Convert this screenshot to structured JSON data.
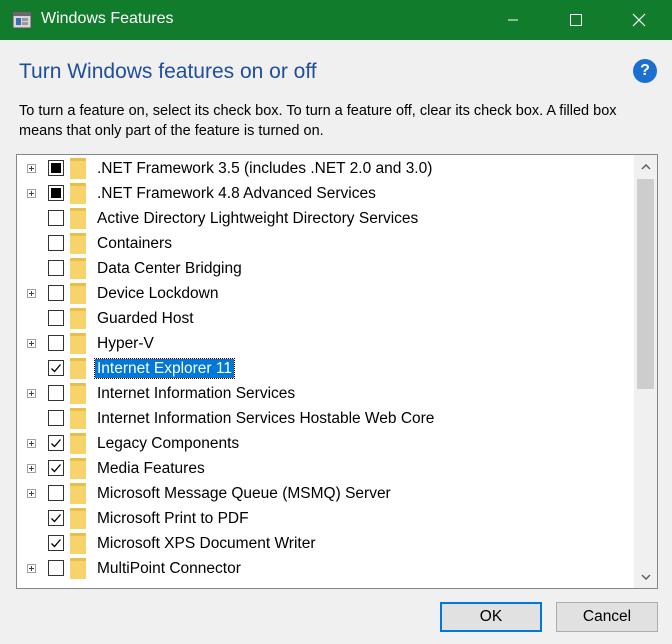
{
  "window": {
    "title": "Windows Features",
    "icon": "windows-features-icon",
    "controls": [
      "minimize-icon",
      "maximize-icon",
      "close-icon"
    ]
  },
  "header": {
    "heading": "Turn Windows features on or off",
    "help_icon": "?",
    "description": "To turn a feature on, select its check box. To turn a feature off, clear its check box. A filled box means that only part of the feature is turned on."
  },
  "features": [
    {
      "label": ".NET Framework 3.5 (includes .NET 2.0 and 3.0)",
      "expandable": true,
      "state": "partial"
    },
    {
      "label": ".NET Framework 4.8 Advanced Services",
      "expandable": true,
      "state": "partial"
    },
    {
      "label": "Active Directory Lightweight Directory Services",
      "expandable": false,
      "state": "unchecked"
    },
    {
      "label": "Containers",
      "expandable": false,
      "state": "unchecked"
    },
    {
      "label": "Data Center Bridging",
      "expandable": false,
      "state": "unchecked"
    },
    {
      "label": "Device Lockdown",
      "expandable": true,
      "state": "unchecked"
    },
    {
      "label": "Guarded Host",
      "expandable": false,
      "state": "unchecked"
    },
    {
      "label": "Hyper-V",
      "expandable": true,
      "state": "unchecked"
    },
    {
      "label": "Internet Explorer 11",
      "expandable": false,
      "state": "checked",
      "selected": true
    },
    {
      "label": "Internet Information Services",
      "expandable": true,
      "state": "unchecked"
    },
    {
      "label": "Internet Information Services Hostable Web Core",
      "expandable": false,
      "state": "unchecked"
    },
    {
      "label": "Legacy Components",
      "expandable": true,
      "state": "checked"
    },
    {
      "label": "Media Features",
      "expandable": true,
      "state": "checked"
    },
    {
      "label": "Microsoft Message Queue (MSMQ) Server",
      "expandable": true,
      "state": "unchecked"
    },
    {
      "label": "Microsoft Print to PDF",
      "expandable": false,
      "state": "checked"
    },
    {
      "label": "Microsoft XPS Document Writer",
      "expandable": false,
      "state": "checked"
    },
    {
      "label": "MultiPoint Connector",
      "expandable": true,
      "state": "unchecked"
    }
  ],
  "buttons": {
    "ok": "OK",
    "cancel": "Cancel"
  },
  "colors": {
    "titlebar": "#107c2c",
    "heading": "#1f4e9a",
    "selection": "#0078d7",
    "folder": "#f7d46b"
  }
}
